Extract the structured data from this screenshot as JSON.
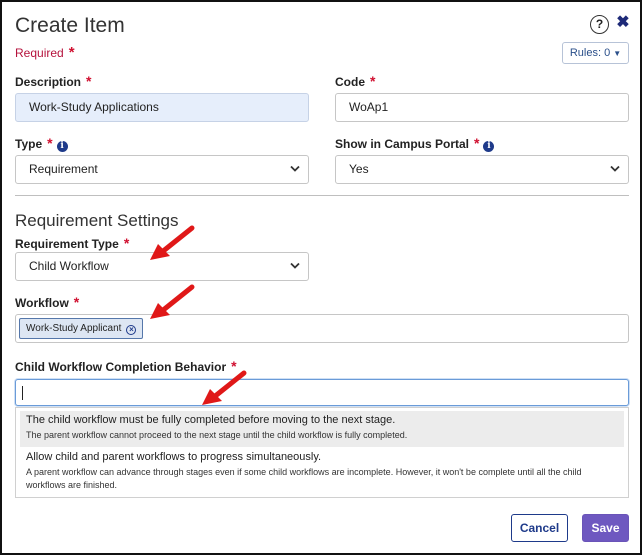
{
  "dialog": {
    "title": "Create Item",
    "required_note": "Required",
    "required_marker": "*",
    "help_label": "?",
    "close_label": "✖",
    "rules_label": "Rules: 0"
  },
  "fields": {
    "description": {
      "label": "Description",
      "value": "Work-Study Applications"
    },
    "code": {
      "label": "Code",
      "value": "WoAp1"
    },
    "type": {
      "label": "Type",
      "value": "Requirement"
    },
    "campus_portal": {
      "label": "Show in Campus Portal",
      "value": "Yes"
    }
  },
  "section": {
    "title": "Requirement Settings",
    "requirement_type": {
      "label": "Requirement Type",
      "value": "Child Workflow"
    },
    "workflow": {
      "label": "Workflow",
      "chip": "Work-Study Applicant"
    },
    "completion": {
      "label": "Child Workflow Completion Behavior",
      "value": "",
      "options": [
        {
          "title": "The child workflow must be fully completed before moving to the next stage.",
          "description": "The parent workflow cannot proceed to the next stage until the child workflow is fully completed."
        },
        {
          "title": "Allow child and parent workflows to progress simultaneously.",
          "description": "A parent workflow can advance through stages even if some child workflows are incomplete. However, it won't be complete until all the child workflows are finished."
        }
      ]
    }
  },
  "buttons": {
    "cancel": "Cancel",
    "save": "Save"
  },
  "icons": {
    "info": "info-icon",
    "chevron": "chevron-down-icon",
    "chip_remove": "close-circle-icon",
    "annotation": "red-arrow-icon"
  },
  "colors": {
    "accent": "#6e58c0",
    "required": "#d01030",
    "link": "#1e3a8a",
    "arrow": "#e01818"
  }
}
